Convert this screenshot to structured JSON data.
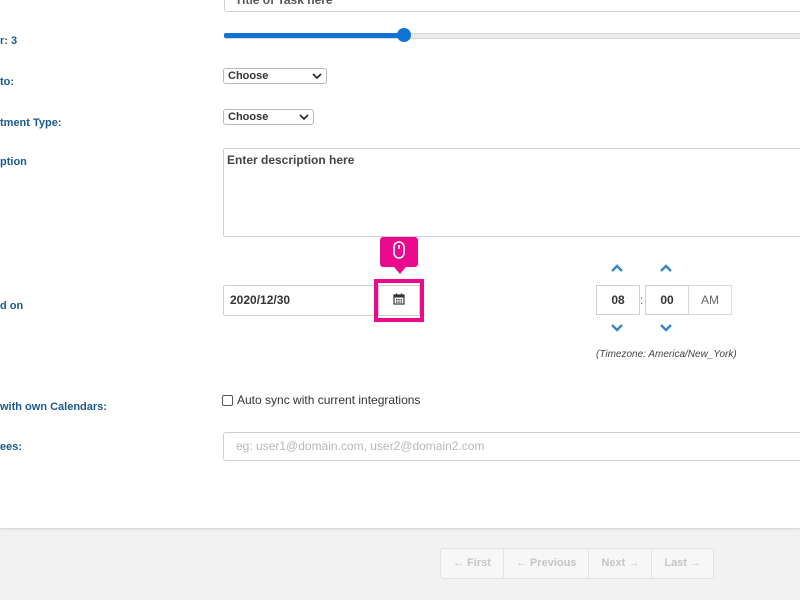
{
  "form": {
    "title_placeholder": "Title of Task here",
    "counter_label": "r: 3",
    "slider": {
      "value_fraction": 0.31,
      "color": "#1173d4"
    },
    "assign_to_label": "to:",
    "assign_to_select": "Choose",
    "appointment_type_label": "tment Type:",
    "appointment_type_select": "Choose",
    "description_label": "ption",
    "description_placeholder": "Enter description here",
    "scheduled_on_label": "d on",
    "date_value": "2020/12/30",
    "time": {
      "hour": "08",
      "minute": "00",
      "separator": ":",
      "ampm": "AM"
    },
    "timezone": "(Timezone: America/New_York)",
    "sync_label": "with own Calendars:",
    "sync_checkbox_label": "Auto sync with current integrations",
    "invitees_label": "ees:",
    "invitees_placeholder": "eg: user1@domain.com, user2@domain2.com"
  },
  "pager": {
    "first": "← First",
    "previous": "← Previous",
    "next": "Next →",
    "last": "Last →"
  },
  "icons": {
    "calendar": "calendar-icon",
    "mouse": "mouse-icon",
    "up": "chevron-up-icon",
    "down": "chevron-down-icon"
  },
  "colors": {
    "highlight": "#ec0a8c",
    "label": "#1a5a8e",
    "arrow": "#3a86c4"
  }
}
